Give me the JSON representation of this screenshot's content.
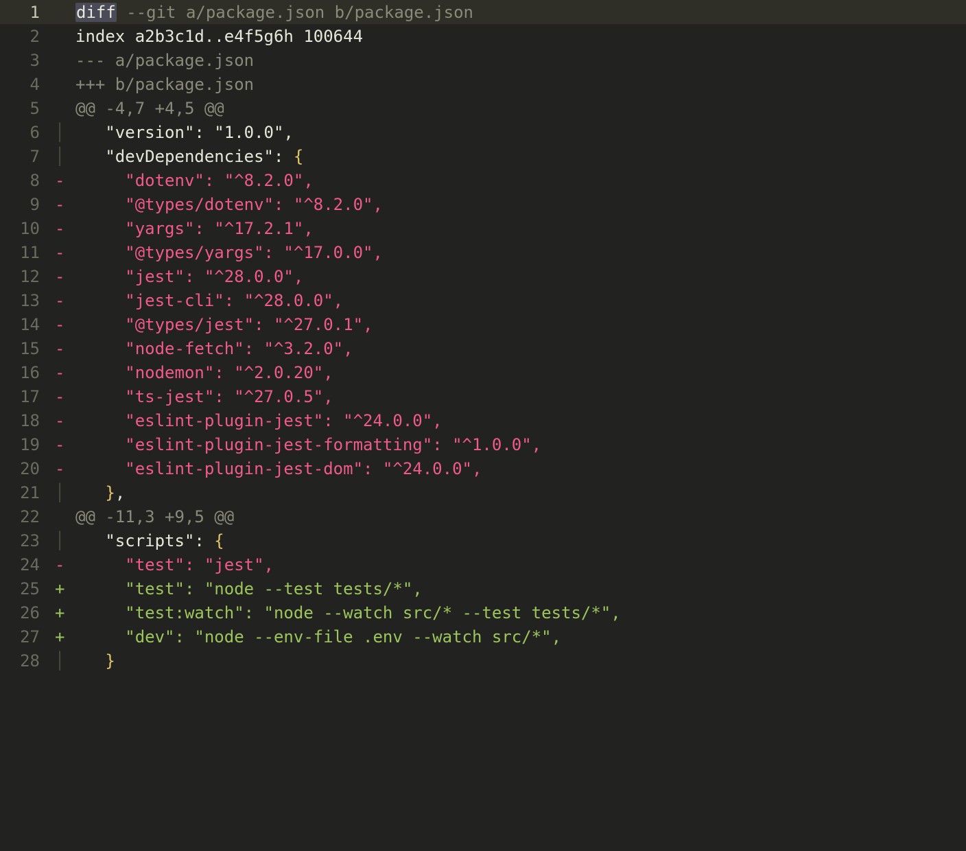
{
  "lines": [
    {
      "num": "1",
      "highlight": true,
      "marker": {
        "text": "",
        "cls": ""
      },
      "segs": [
        {
          "text": "diff",
          "cls": "sel"
        },
        {
          "text": " --git a/package.json b/package.json",
          "cls": "c-dim"
        }
      ]
    },
    {
      "num": "2",
      "highlight": false,
      "marker": {
        "text": "",
        "cls": ""
      },
      "segs": [
        {
          "text": "index a2b3c1d..e4f5g6h 100644",
          "cls": "c-white"
        }
      ]
    },
    {
      "num": "3",
      "highlight": false,
      "marker": {
        "text": "",
        "cls": ""
      },
      "segs": [
        {
          "text": "--- a/package.json",
          "cls": "c-dim"
        }
      ]
    },
    {
      "num": "4",
      "highlight": false,
      "marker": {
        "text": "",
        "cls": ""
      },
      "segs": [
        {
          "text": "+++ b/package.json",
          "cls": "c-dim"
        }
      ]
    },
    {
      "num": "5",
      "highlight": false,
      "marker": {
        "text": "",
        "cls": ""
      },
      "segs": [
        {
          "text": "@@ -4,7 +4,5 @@",
          "cls": "c-dim"
        }
      ]
    },
    {
      "num": "6",
      "highlight": false,
      "marker": {
        "text": "│",
        "cls": "marker-pipe"
      },
      "segs": [
        {
          "text": "   \"version\": \"1.0.0\",",
          "cls": "c-white"
        }
      ]
    },
    {
      "num": "7",
      "highlight": false,
      "marker": {
        "text": "│",
        "cls": "marker-pipe"
      },
      "segs": [
        {
          "text": "   \"devDependencies\": ",
          "cls": "c-white"
        },
        {
          "text": "{",
          "cls": "c-yellow"
        }
      ]
    },
    {
      "num": "8",
      "highlight": false,
      "marker": {
        "text": "-",
        "cls": "marker-minus"
      },
      "segs": [
        {
          "text": "     \"dotenv\": \"^8.2.0\",",
          "cls": "c-red"
        }
      ]
    },
    {
      "num": "9",
      "highlight": false,
      "marker": {
        "text": "-",
        "cls": "marker-minus"
      },
      "segs": [
        {
          "text": "     \"@types/dotenv\": \"^8.2.0\",",
          "cls": "c-red"
        }
      ]
    },
    {
      "num": "10",
      "highlight": false,
      "marker": {
        "text": "-",
        "cls": "marker-minus"
      },
      "segs": [
        {
          "text": "     \"yargs\": \"^17.2.1\",",
          "cls": "c-red"
        }
      ]
    },
    {
      "num": "11",
      "highlight": false,
      "marker": {
        "text": "-",
        "cls": "marker-minus"
      },
      "segs": [
        {
          "text": "     \"@types/yargs\": \"^17.0.0\",",
          "cls": "c-red"
        }
      ]
    },
    {
      "num": "12",
      "highlight": false,
      "marker": {
        "text": "-",
        "cls": "marker-minus"
      },
      "segs": [
        {
          "text": "     \"jest\": \"^28.0.0\",",
          "cls": "c-red"
        }
      ]
    },
    {
      "num": "13",
      "highlight": false,
      "marker": {
        "text": "-",
        "cls": "marker-minus"
      },
      "segs": [
        {
          "text": "     \"jest-cli\": \"^28.0.0\",",
          "cls": "c-red"
        }
      ]
    },
    {
      "num": "14",
      "highlight": false,
      "marker": {
        "text": "-",
        "cls": "marker-minus"
      },
      "segs": [
        {
          "text": "     \"@types/jest\": \"^27.0.1\",",
          "cls": "c-red"
        }
      ]
    },
    {
      "num": "15",
      "highlight": false,
      "marker": {
        "text": "-",
        "cls": "marker-minus"
      },
      "segs": [
        {
          "text": "     \"node-fetch\": \"^3.2.0\",",
          "cls": "c-red"
        }
      ]
    },
    {
      "num": "16",
      "highlight": false,
      "marker": {
        "text": "-",
        "cls": "marker-minus"
      },
      "segs": [
        {
          "text": "     \"nodemon\": \"^2.0.20\",",
          "cls": "c-red"
        }
      ]
    },
    {
      "num": "17",
      "highlight": false,
      "marker": {
        "text": "-",
        "cls": "marker-minus"
      },
      "segs": [
        {
          "text": "     \"ts-jest\": \"^27.0.5\",",
          "cls": "c-red"
        }
      ]
    },
    {
      "num": "18",
      "highlight": false,
      "marker": {
        "text": "-",
        "cls": "marker-minus"
      },
      "segs": [
        {
          "text": "     \"eslint-plugin-jest\": \"^24.0.0\",",
          "cls": "c-red"
        }
      ]
    },
    {
      "num": "19",
      "highlight": false,
      "marker": {
        "text": "-",
        "cls": "marker-minus"
      },
      "segs": [
        {
          "text": "     \"eslint-plugin-jest-formatting\": \"^1.0.0\",",
          "cls": "c-red"
        }
      ]
    },
    {
      "num": "20",
      "highlight": false,
      "marker": {
        "text": "-",
        "cls": "marker-minus"
      },
      "segs": [
        {
          "text": "     \"eslint-plugin-jest-dom\": \"^24.0.0\",",
          "cls": "c-red"
        }
      ]
    },
    {
      "num": "21",
      "highlight": false,
      "marker": {
        "text": "│",
        "cls": "marker-pipe"
      },
      "segs": [
        {
          "text": "   ",
          "cls": "c-white"
        },
        {
          "text": "}",
          "cls": "c-yellow"
        },
        {
          "text": ",",
          "cls": "c-white"
        }
      ]
    },
    {
      "num": "22",
      "highlight": false,
      "marker": {
        "text": "",
        "cls": ""
      },
      "segs": [
        {
          "text": "@@ -11,3 +9,5 @@",
          "cls": "c-dim"
        }
      ]
    },
    {
      "num": "23",
      "highlight": false,
      "marker": {
        "text": "│",
        "cls": "marker-pipe"
      },
      "segs": [
        {
          "text": "   \"scripts\": ",
          "cls": "c-white"
        },
        {
          "text": "{",
          "cls": "c-yellow"
        }
      ]
    },
    {
      "num": "24",
      "highlight": false,
      "marker": {
        "text": "-",
        "cls": "marker-minus"
      },
      "segs": [
        {
          "text": "     \"test\": \"jest\",",
          "cls": "c-red"
        }
      ]
    },
    {
      "num": "25",
      "highlight": false,
      "marker": {
        "text": "+",
        "cls": "marker-plus"
      },
      "segs": [
        {
          "text": "     \"test\": \"node --test tests/*\",",
          "cls": "c-green"
        }
      ]
    },
    {
      "num": "26",
      "highlight": false,
      "marker": {
        "text": "+",
        "cls": "marker-plus"
      },
      "segs": [
        {
          "text": "     \"test:watch\": \"node --watch src/* --test tests/*\",",
          "cls": "c-green"
        }
      ]
    },
    {
      "num": "27",
      "highlight": false,
      "marker": {
        "text": "+",
        "cls": "marker-plus"
      },
      "segs": [
        {
          "text": "     \"dev\": \"node --env-file .env --watch src/*\",",
          "cls": "c-green"
        }
      ]
    },
    {
      "num": "28",
      "highlight": false,
      "marker": {
        "text": "│",
        "cls": "marker-pipe"
      },
      "segs": [
        {
          "text": "   ",
          "cls": "c-white"
        },
        {
          "text": "}",
          "cls": "c-yellow"
        }
      ]
    }
  ]
}
